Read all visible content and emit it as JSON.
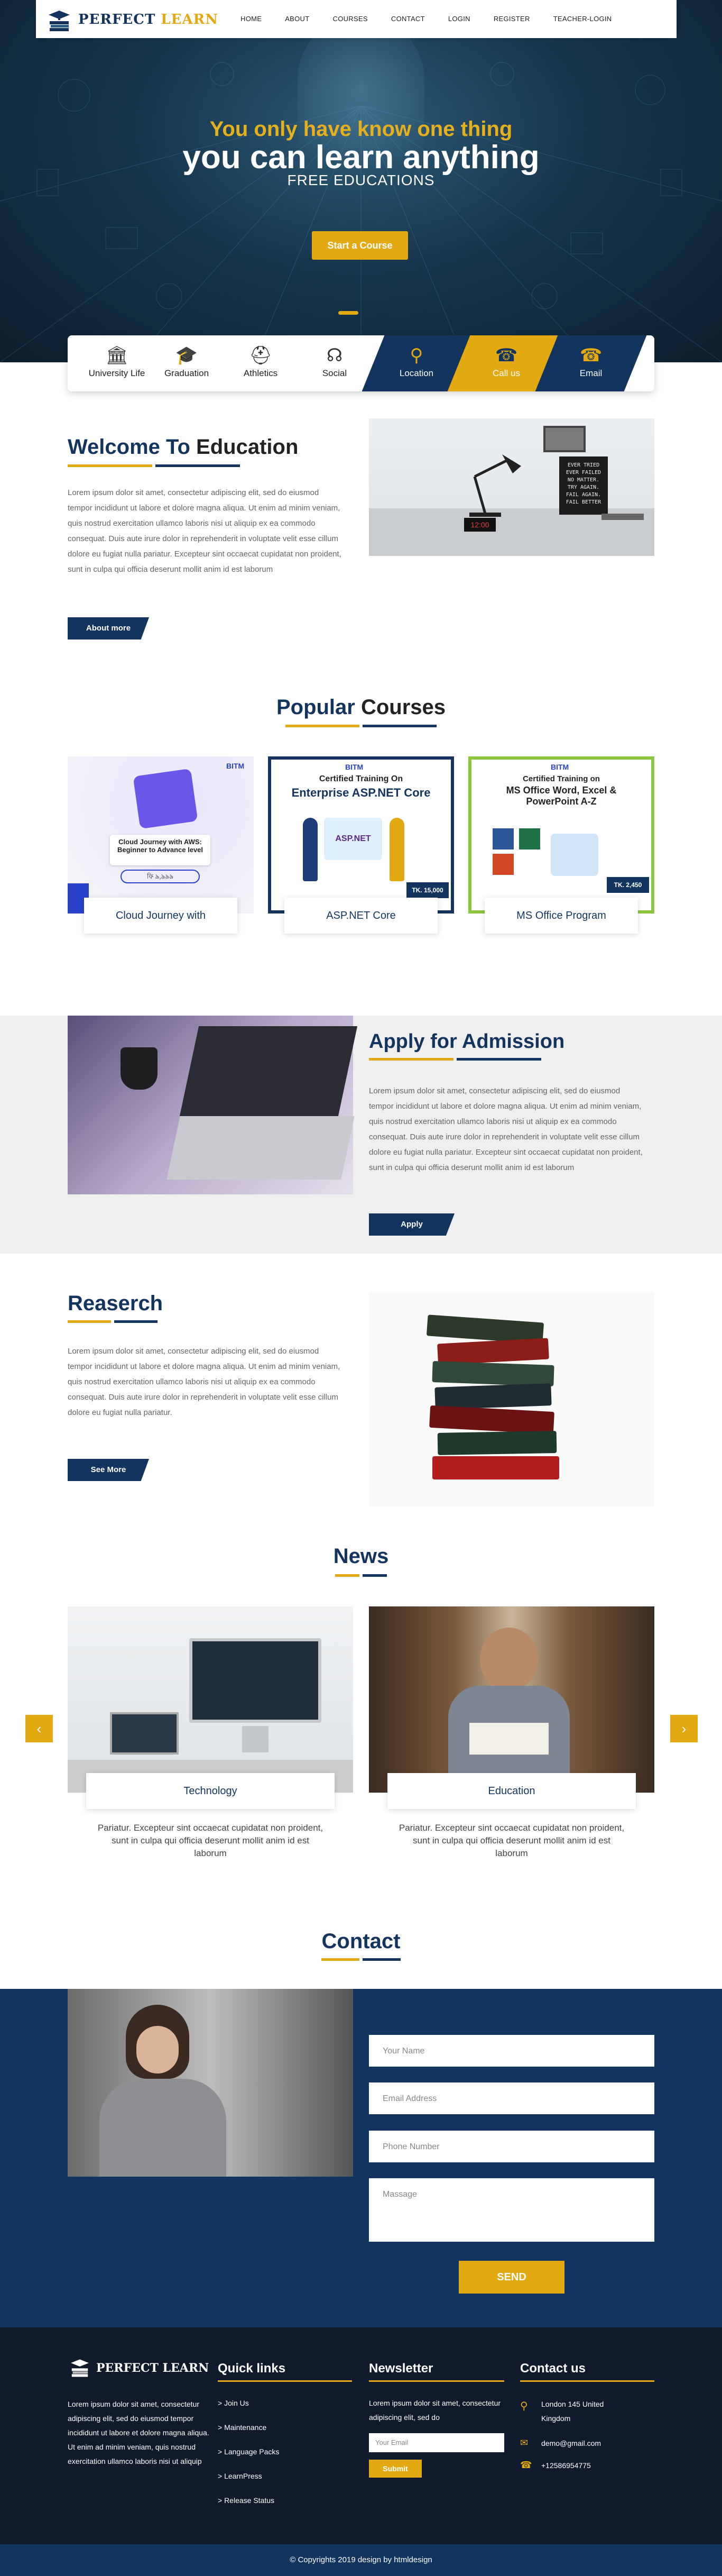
{
  "brand": {
    "part1": "PERFECT",
    "part2": "LEARN"
  },
  "nav": [
    "HOME",
    "ABOUT",
    "COURSES",
    "CONTACT",
    "LOGIN",
    "REGISTER",
    "TEACHER-LOGIN"
  ],
  "hero": {
    "line1": "You only have know one thing",
    "line2": "you can learn anything",
    "line3": "FREE EDUCATIONS",
    "button": "Start a Course"
  },
  "features": [
    {
      "label": "University Life",
      "icon": "building-icon"
    },
    {
      "label": "Graduation",
      "icon": "graduation-cap-icon"
    },
    {
      "label": "Athletics",
      "icon": "bench-icon"
    },
    {
      "label": "Social",
      "icon": "social-icon"
    },
    {
      "label": "Location",
      "icon": "map-pin-icon"
    },
    {
      "label": "Call us",
      "icon": "phone-icon"
    },
    {
      "label": "Email",
      "icon": "phone-icon"
    }
  ],
  "welcome": {
    "title_a": "Welcome To",
    "title_b": "Education",
    "text": "Lorem ipsum dolor sit amet, consectetur adipiscing elit, sed do eiusmod tempor incididunt ut labore et dolore magna aliqua. Ut enim ad minim veniam, quis nostrud exercitation ullamco laboris nisi ut aliquip ex ea commodo consequat. Duis aute irure dolor in reprehenderit in voluptate velit esse cillum dolore eu fugiat nulla pariatur. Excepteur sint occaecat cupidatat non proident, sunt in culpa qui officia deserunt mollit anim id est laborum",
    "button": "About more",
    "sign_lines": [
      "EVER TRIED",
      "EVER FAILED",
      "NO MATTER.",
      "TRY AGAIN.",
      "FAIL AGAIN.",
      "FAIL BETTER"
    ]
  },
  "popular": {
    "title_a": "Popular",
    "title_b": "Courses",
    "courses": [
      {
        "label": "Cloud Journey with",
        "img_brand": "BITM",
        "img_title": "Cloud Journey with AWS: Beginner to Advance level",
        "img_sub": "ফি ৯,৯৯৯",
        "color": "#2843c9"
      },
      {
        "label": "ASP.NET Core",
        "img_brand": "BITM",
        "img_title_small": "Certified Training On",
        "img_title": "Enterprise ASP.NET Core",
        "img_sub": "ASP.NET",
        "price": "TK. 15,000",
        "color": "#12345e"
      },
      {
        "label": "MS Office Program",
        "img_brand": "BITM",
        "img_title_small": "Certified Training on",
        "img_title": "MS Office Word, Excel & PowerPoint A-Z",
        "price": "TK. 2,450",
        "color": "#8cc63f"
      }
    ]
  },
  "admission": {
    "title": "Apply for Admission",
    "text": "Lorem ipsum dolor sit amet, consectetur adipiscing elit, sed do eiusmod tempor incididunt ut labore et dolore magna aliqua. Ut enim ad minim veniam, quis nostrud exercitation ullamco laboris nisi ut aliquip ex ea commodo consequat. Duis aute irure dolor in reprehenderit in voluptate velit esse cillum dolore eu fugiat nulla pariatur. Excepteur sint occaecat cupidatat non proident, sunt in culpa qui officia deserunt mollit anim id est laborum",
    "button": "Apply"
  },
  "research": {
    "title": "Reaserch",
    "text": "Lorem ipsum dolor sit amet, consectetur adipiscing elit, sed do eiusmod tempor incididunt ut labore et dolore magna aliqua. Ut enim ad minim veniam, quis nostrud exercitation ullamco laboris nisi ut aliquip ex ea commodo consequat. Duis aute irure dolor in reprehenderit in voluptate velit esse cillum dolore eu fugiat nulla pariatur.",
    "button": "See More"
  },
  "news": {
    "title": "News",
    "items": [
      {
        "label": "Technology",
        "text": "Pariatur. Excepteur sint occaecat cupidatat non proident, sunt in culpa qui officia deserunt mollit anim id est laborum"
      },
      {
        "label": "Education",
        "text": "Pariatur. Excepteur sint occaecat cupidatat non proident, sunt in culpa qui officia deserunt mollit anim id est laborum"
      }
    ]
  },
  "contact": {
    "title": "Contact",
    "name_ph": "Your Name",
    "email_ph": "Email Address",
    "phone_ph": "Phone Number",
    "msg_ph": "Massage",
    "send": "SEND"
  },
  "footer": {
    "brand": "PERFECT LEARN",
    "about": "Lorem ipsum dolor sit amet, consectetur adipiscing elit, sed do eiusmod tempor incididunt ut labore et dolore magna aliqua. Ut enim ad minim veniam, quis nostrud exercitation ullamco laboris nisi ut aliquip",
    "quick_title": "Quick links",
    "links": [
      "> Join Us",
      "> Maintenance",
      "> Language Packs",
      "> LearnPress",
      "> Release Status"
    ],
    "news_title": "Newsletter",
    "news_text": "Lorem ipsum dolor sit amet, consectetur adipiscing elit, sed do",
    "news_ph": "Your Email",
    "news_btn": "Submit",
    "contact_title": "Contact us",
    "address": "London 145 United Kingdom",
    "email": "demo@gmail.com",
    "phone": "+12586954775",
    "copy": "© Copyrights 2019 design by htmldesign"
  },
  "colors": {
    "navy": "#12345e",
    "gold": "#e2a912",
    "footer": "#0f1a2c"
  }
}
